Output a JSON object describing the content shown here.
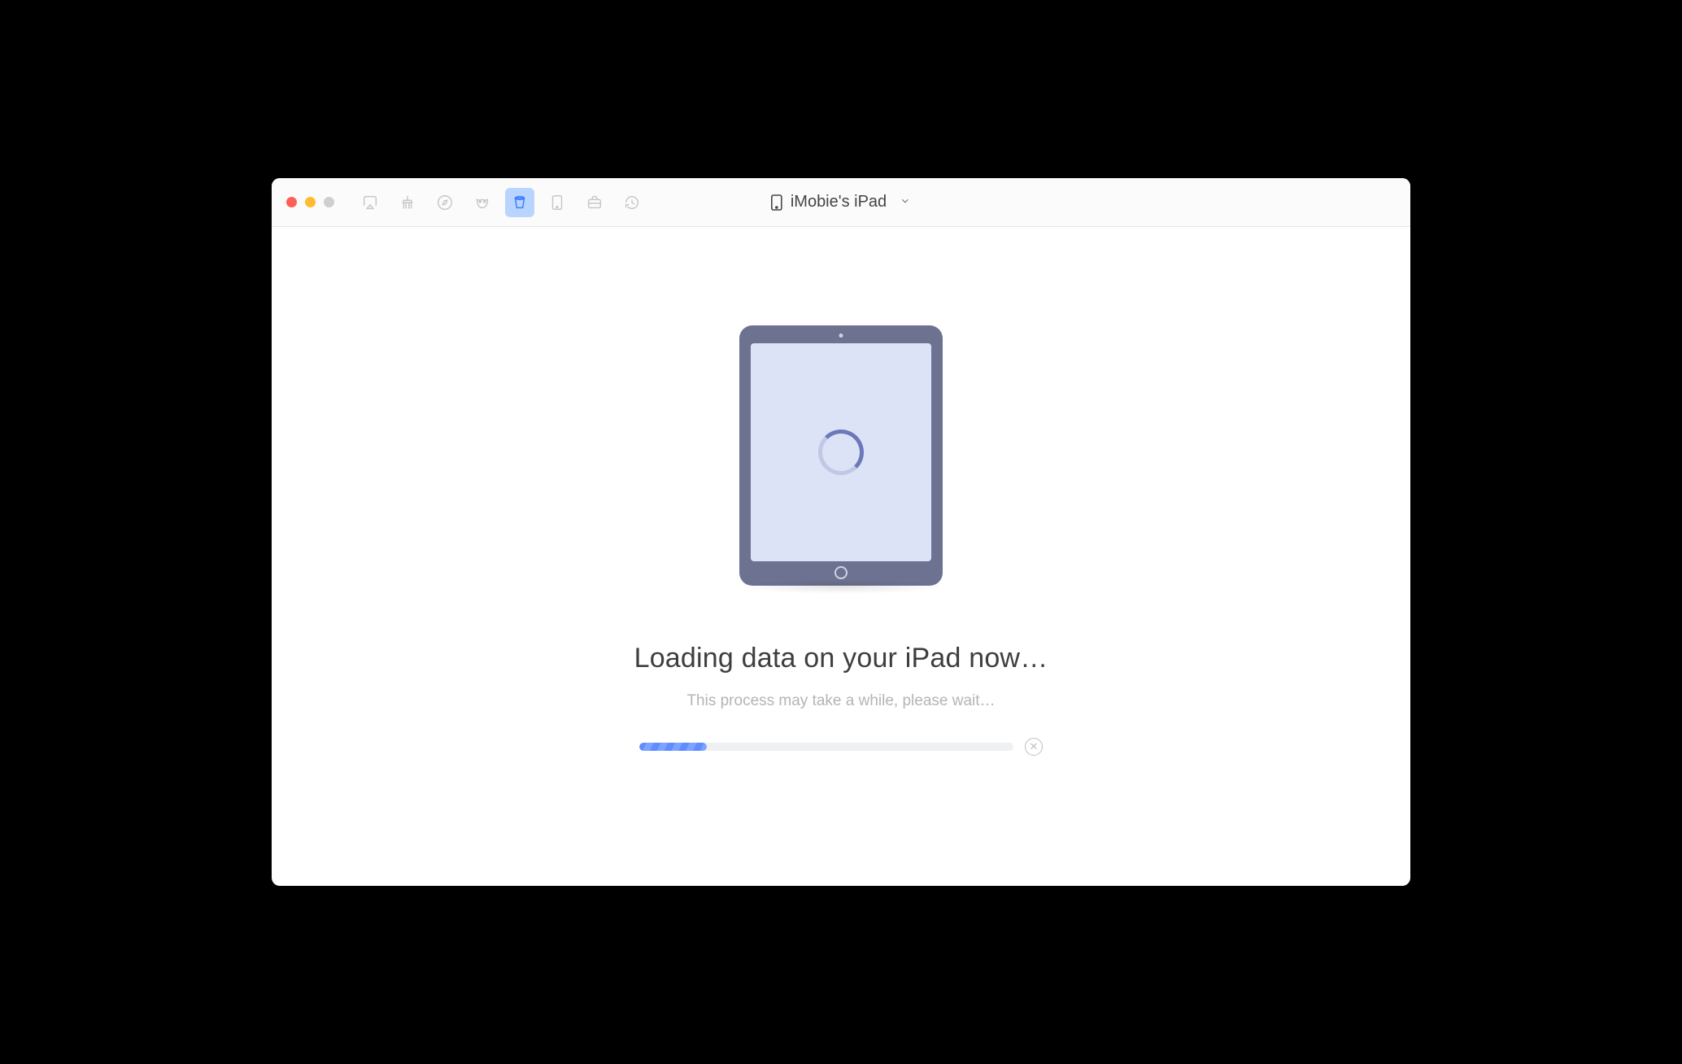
{
  "device": {
    "name": "iMobie's iPad"
  },
  "toolbar": {
    "icons": [
      "airplay",
      "cleanup",
      "compass",
      "mask",
      "bucket",
      "tablet",
      "briefcase",
      "history"
    ],
    "active_index": 4
  },
  "status": {
    "title": "Loading data on your iPad now…",
    "subtitle": "This process may take a while, please wait…"
  },
  "progress": {
    "percent": 18
  }
}
